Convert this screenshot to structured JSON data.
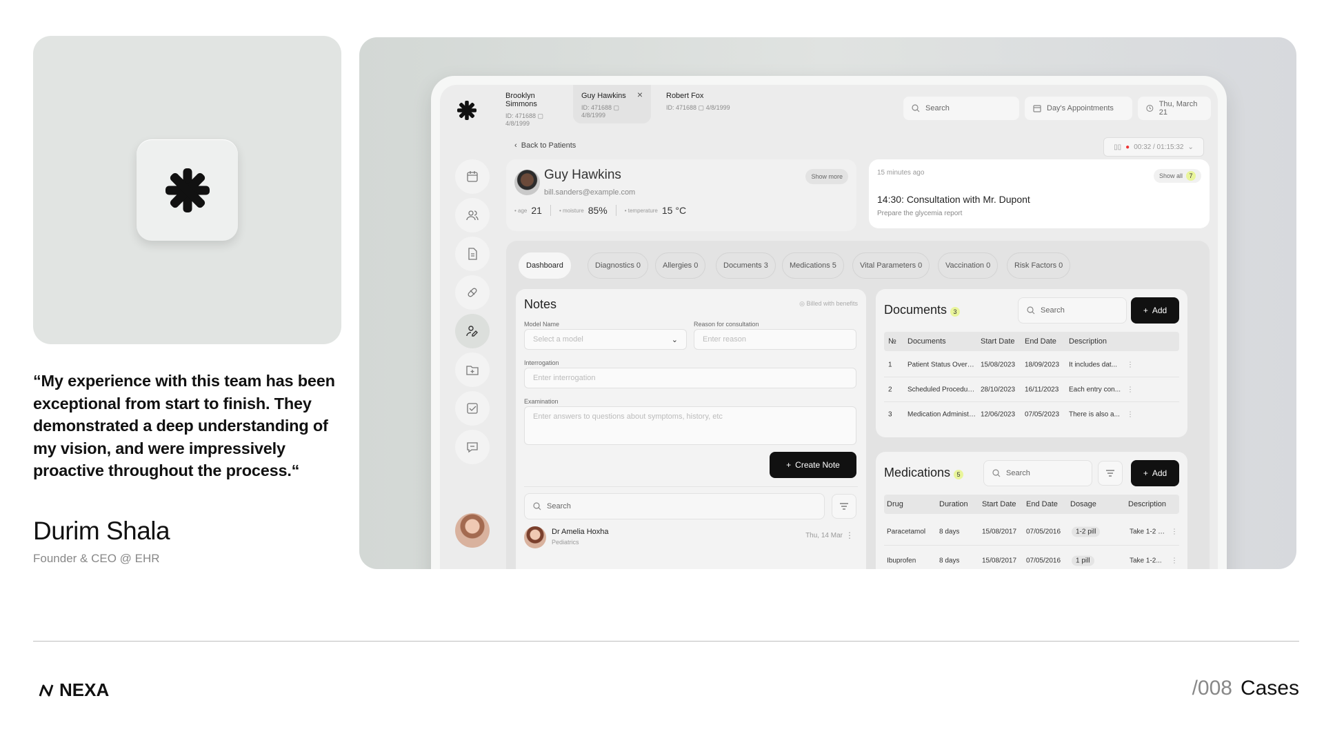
{
  "testimonial": {
    "quote": "“My experience with this team has been exceptional from start to finish. They demonstrated a deep understanding of my vision, and were impressively proactive throughout the process.“",
    "author": "Durim Shala",
    "role": "Founder & CEO @ EHR"
  },
  "footer": {
    "brand": "NEXA",
    "case_number": "/008",
    "case_label": "Cases"
  },
  "app": {
    "patient_tabs": [
      {
        "name": "Brooklyn Simmons",
        "id": "ID: 471688",
        "dob": "4/8/1999"
      },
      {
        "name": "Guy Hawkins",
        "id": "ID: 471688",
        "dob": "4/8/1999"
      },
      {
        "name": "Robert Fox",
        "id": "ID: 471688",
        "dob": "4/8/1999"
      }
    ],
    "header": {
      "search_placeholder": "Search",
      "appointments": "Day's Appointments",
      "date": "Thu, March 21"
    },
    "back_label": "Back to Patients",
    "timer": "00:32 / 01:15:32",
    "patient": {
      "name": "Guy Hawkins",
      "email": "bill.sanders@example.com",
      "show_more": "Show more",
      "age_label": "age",
      "age": "21",
      "moisture_label": "moisture",
      "moisture": "85%",
      "temperature_label": "temperature",
      "temperature": "15 °C"
    },
    "appointment": {
      "ago": "15 minutes ago",
      "show_all": "Show all",
      "count": "7",
      "title": "14:30: Consultation with Mr. Dupont",
      "subtitle": "Prepare the glycemia report"
    },
    "dash_tabs": [
      {
        "label": "Dashboard"
      },
      {
        "label": "Diagnostics 0"
      },
      {
        "label": "Allergies 0"
      },
      {
        "label": "Documents 3"
      },
      {
        "label": "Medications 5"
      },
      {
        "label": "Vital Parameters 0"
      },
      {
        "label": "Vaccination 0"
      },
      {
        "label": "Risk Factors 0"
      }
    ],
    "notes": {
      "title": "Notes",
      "billed": "Billed with benefits",
      "model_label": "Model Name",
      "model_placeholder": "Select a model",
      "reason_label": "Reason for consultation",
      "reason_placeholder": "Enter reason",
      "interrogation_label": "Interrogation",
      "interrogation_placeholder": "Enter interrogation",
      "examination_label": "Examination",
      "examination_placeholder": "Enter answers to questions about symptoms, history, etc",
      "create_label": "Create Note",
      "search_placeholder": "Search",
      "entry": {
        "doctor": "Dr Amelia Hoxha",
        "specialty": "Pediatrics",
        "date": "Thu, 14 Mar"
      }
    },
    "documents": {
      "title": "Documents",
      "count": "3",
      "search_placeholder": "Search",
      "add_label": "Add",
      "columns": [
        "№",
        "Documents",
        "Start Date",
        "End Date",
        "Description"
      ],
      "rows": [
        [
          "1",
          "Patient Status Overvie...",
          "15/08/2023",
          "18/09/2023",
          "It includes dat..."
        ],
        [
          "2",
          "Scheduled Procedures...",
          "28/10/2023",
          "16/11/2023",
          "Each entry con..."
        ],
        [
          "3",
          "Medication Administrat...",
          "12/06/2023",
          "07/05/2023",
          "There is also a..."
        ]
      ]
    },
    "medications": {
      "title": "Medications",
      "count": "5",
      "search_placeholder": "Search",
      "add_label": "Add",
      "columns": [
        "Drug",
        "Duration",
        "Start Date",
        "End Date",
        "Dosage",
        "Description"
      ],
      "rows": [
        [
          "Paracetamol",
          "8 days",
          "15/08/2017",
          "07/05/2016",
          "1-2 pill",
          "Take 1-2 p..."
        ],
        [
          "Ibuprofen",
          "8 days",
          "15/08/2017",
          "07/05/2016",
          "1 pill",
          "Take 1-2..."
        ]
      ]
    }
  }
}
